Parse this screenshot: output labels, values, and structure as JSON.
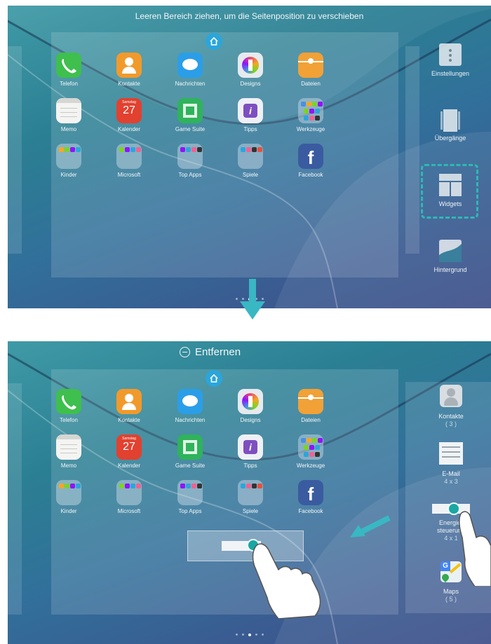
{
  "top_screen": {
    "hint": "Leeren Bereich ziehen, um die Seitenposition zu verschieben",
    "apps": [
      {
        "label": "Telefon",
        "icon": "phone-icon",
        "color": "#3fbf4d"
      },
      {
        "label": "Kontakte",
        "icon": "contacts-icon",
        "color": "#f19a2c"
      },
      {
        "label": "Nachrichten",
        "icon": "messages-icon",
        "color": "#2b9ee8"
      },
      {
        "label": "Designs",
        "icon": "designs-icon",
        "color": "#e6eaee"
      },
      {
        "label": "Dateien",
        "icon": "files-icon",
        "color": "#f1a136"
      },
      {
        "label": "Memo",
        "icon": "memo-icon",
        "color": "#f4f4f2"
      },
      {
        "label": "Kalender",
        "icon": "calendar-icon",
        "color": "#e2412f",
        "calendar_day": "Samstag",
        "calendar_date": "27"
      },
      {
        "label": "Game Suite",
        "icon": "game-suite-icon",
        "color": "#2fb35b"
      },
      {
        "label": "Tipps",
        "icon": "tips-icon",
        "color": "#7e4fc0"
      },
      {
        "label": "Werkzeuge",
        "icon": "tools-folder-icon",
        "color": "#8fa7c6"
      },
      {
        "label": "Kinder",
        "icon": "kids-folder-icon",
        "color": "#8fa7c6"
      },
      {
        "label": "Microsoft",
        "icon": "microsoft-folder-icon",
        "color": "#8fa7c6"
      },
      {
        "label": "Top Apps",
        "icon": "top-apps-folder-icon",
        "color": "#8fa7c6"
      },
      {
        "label": "Spiele",
        "icon": "games-folder-icon",
        "color": "#8fa7c6"
      },
      {
        "label": "Facebook",
        "icon": "facebook-icon",
        "color": "#3b5ba0"
      }
    ],
    "options": [
      {
        "label": "Einstellungen",
        "icon": "settings-icon"
      },
      {
        "label": "Übergänge",
        "icon": "transitions-icon"
      },
      {
        "label": "Widgets",
        "icon": "widgets-icon"
      },
      {
        "label": "Hintergrund",
        "icon": "wallpaper-icon"
      }
    ],
    "page_dots": 5,
    "active_dot": 2
  },
  "bottom_screen": {
    "remove_label": "Entfernen",
    "widgets": [
      {
        "label": "Kontakte",
        "sub": "( 3 )",
        "icon": "contact-widget-icon"
      },
      {
        "label": "E-Mail",
        "sub": "4 x 3",
        "icon": "email-widget-icon"
      },
      {
        "label": "Energie-\nsteuerung",
        "sub": "4 x 1",
        "icon": "energy-widget-icon"
      },
      {
        "label": "Maps",
        "sub": "( 5 )",
        "icon": "maps-icon"
      }
    ],
    "page_dots": 5,
    "active_dot": 2
  },
  "colors": {
    "accent": "#2eb8b5",
    "arrow": "#39b7c3"
  }
}
